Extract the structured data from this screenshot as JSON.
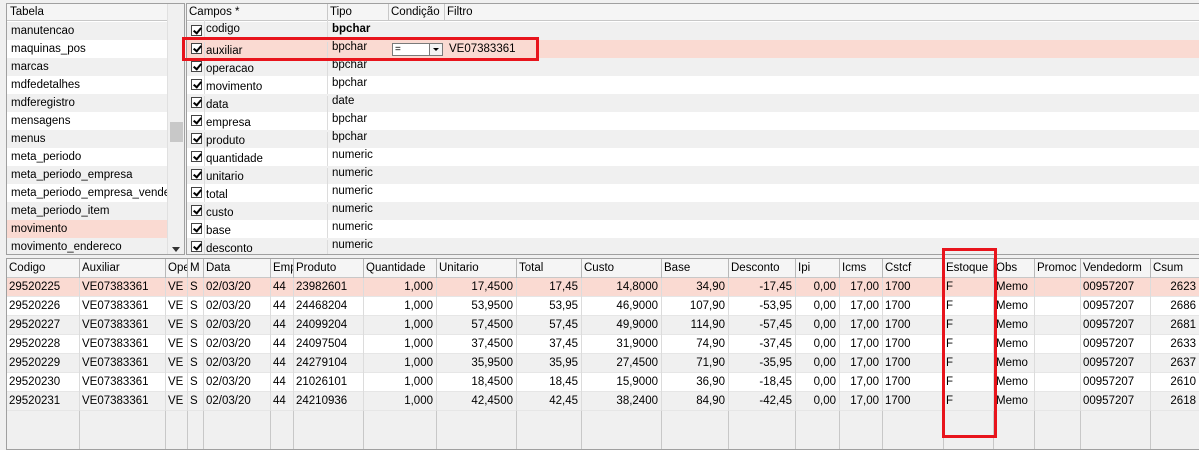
{
  "tabela": {
    "header": "Tabela",
    "items": [
      "manutencao",
      "maquinas_pos",
      "marcas",
      "mdfedetalhes",
      "mdferegistro",
      "mensagens",
      "menus",
      "meta_periodo",
      "meta_periodo_empresa",
      "meta_periodo_empresa_vendedor",
      "meta_periodo_item",
      "movimento",
      "movimento_endereco"
    ],
    "selected": "movimento"
  },
  "campos": {
    "headers": {
      "campos": "Campos *",
      "tipo": "Tipo",
      "condicao": "Condição",
      "filtro": "Filtro"
    },
    "rows": [
      {
        "name": "codigo",
        "tipo": "bpchar",
        "bold": true
      },
      {
        "name": "auxiliar",
        "tipo": "bpchar",
        "condicao": "=",
        "filtro": "VE07383361"
      },
      {
        "name": "operacao",
        "tipo": "bpchar"
      },
      {
        "name": "movimento",
        "tipo": "bpchar"
      },
      {
        "name": "data",
        "tipo": "date"
      },
      {
        "name": "empresa",
        "tipo": "bpchar"
      },
      {
        "name": "produto",
        "tipo": "bpchar"
      },
      {
        "name": "quantidade",
        "tipo": "numeric"
      },
      {
        "name": "unitario",
        "tipo": "numeric"
      },
      {
        "name": "total",
        "tipo": "numeric"
      },
      {
        "name": "custo",
        "tipo": "numeric"
      },
      {
        "name": "base",
        "tipo": "numeric"
      },
      {
        "name": "desconto",
        "tipo": "numeric"
      }
    ]
  },
  "grid": {
    "headers": [
      "Codigo",
      "Auxiliar",
      "Operacao",
      "Movimento",
      "Data",
      "Empresa",
      "Produto",
      "Quantidade",
      "Unitario",
      "Total",
      "Custo",
      "Base",
      "Desconto",
      "Ipi",
      "Icms",
      "Cstcf",
      "Estoque",
      "Obs",
      "Promocao",
      "Vendedorm",
      "Csum"
    ],
    "header_display": [
      "Codigo",
      "Auxiliar",
      "Ope",
      "M",
      "Data",
      "Emp",
      "Produto",
      "Quantidade",
      "Unitario",
      "Total",
      "Custo",
      "Base",
      "Desconto",
      "Ipi",
      "Icms",
      "Cstcf",
      "Estoque",
      "Obs",
      "Promoc",
      "Vendedorm",
      "Csum"
    ],
    "rows": [
      [
        "29520225",
        "VE07383361",
        "VE",
        "S",
        "02/03/20",
        "44",
        "23982601",
        "1,000",
        "17,4500",
        "17,45",
        "14,8000",
        "34,90",
        "-17,45",
        "0,00",
        "17,00",
        "1700",
        "F",
        "Memo",
        "",
        "00957207",
        "2623"
      ],
      [
        "29520226",
        "VE07383361",
        "VE",
        "S",
        "02/03/20",
        "44",
        "24468204",
        "1,000",
        "53,9500",
        "53,95",
        "46,9000",
        "107,90",
        "-53,95",
        "0,00",
        "17,00",
        "1700",
        "F",
        "Memo",
        "",
        "00957207",
        "2686"
      ],
      [
        "29520227",
        "VE07383361",
        "VE",
        "S",
        "02/03/20",
        "44",
        "24099204",
        "1,000",
        "57,4500",
        "57,45",
        "49,9000",
        "114,90",
        "-57,45",
        "0,00",
        "17,00",
        "1700",
        "F",
        "Memo",
        "",
        "00957207",
        "2681"
      ],
      [
        "29520228",
        "VE07383361",
        "VE",
        "S",
        "02/03/20",
        "44",
        "24097504",
        "1,000",
        "37,4500",
        "37,45",
        "31,9000",
        "74,90",
        "-37,45",
        "0,00",
        "17,00",
        "1700",
        "F",
        "Memo",
        "",
        "00957207",
        "2633"
      ],
      [
        "29520229",
        "VE07383361",
        "VE",
        "S",
        "02/03/20",
        "44",
        "24279104",
        "1,000",
        "35,9500",
        "35,95",
        "27,4500",
        "71,90",
        "-35,95",
        "0,00",
        "17,00",
        "1700",
        "F",
        "Memo",
        "",
        "00957207",
        "2637"
      ],
      [
        "29520230",
        "VE07383361",
        "VE",
        "S",
        "02/03/20",
        "44",
        "21026101",
        "1,000",
        "18,4500",
        "18,45",
        "15,9000",
        "36,90",
        "-18,45",
        "0,00",
        "17,00",
        "1700",
        "F",
        "Memo",
        "",
        "00957207",
        "2610"
      ],
      [
        "29520231",
        "VE07383361",
        "VE",
        "S",
        "02/03/20",
        "44",
        "24210936",
        "1,000",
        "42,4500",
        "42,45",
        "38,2400",
        "84,90",
        "-42,45",
        "0,00",
        "17,00",
        "1700",
        "F",
        "Memo",
        "",
        "00957207",
        "2618"
      ]
    ]
  },
  "colors": {
    "selection": "#fadad2",
    "highlight_box": "#e8141c"
  },
  "icons": {
    "checkbox": "checkbox-checked-icon",
    "dropdown": "chevron-down-icon",
    "scroll_down": "scroll-down-arrow-icon"
  }
}
